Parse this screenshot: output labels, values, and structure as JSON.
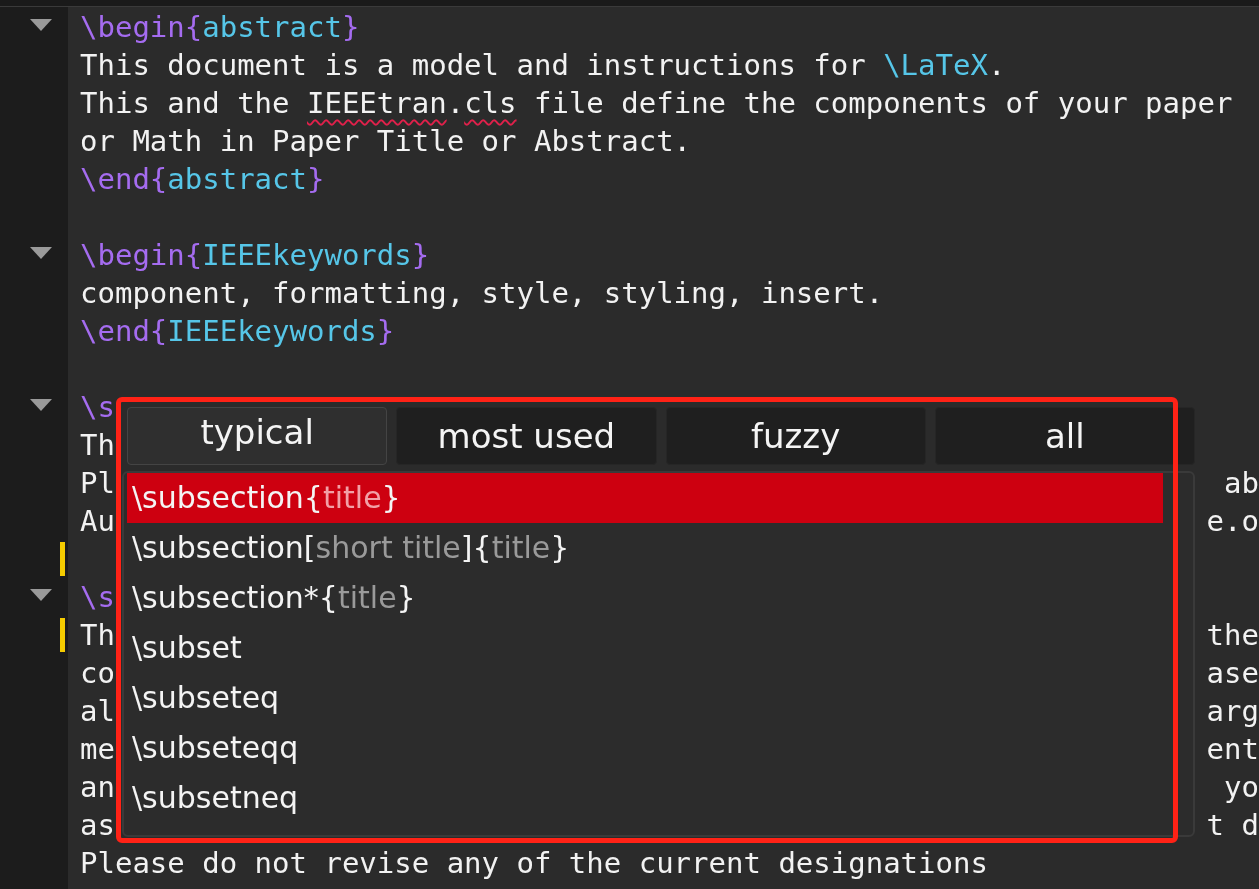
{
  "editor": {
    "lines": [
      {
        "fold": true,
        "marker": false,
        "left": [
          {
            "kind": "cmd",
            "text": "\\begin"
          },
          {
            "kind": "brace",
            "text": "{"
          },
          {
            "kind": "arg",
            "text": "abstract"
          },
          {
            "kind": "brace",
            "text": "}"
          }
        ]
      },
      {
        "fold": false,
        "marker": false,
        "left": [
          {
            "kind": "text",
            "text": "This document is a model and instructions for "
          },
          {
            "kind": "arg",
            "text": "\\LaTeX"
          },
          {
            "kind": "text",
            "text": "."
          }
        ]
      },
      {
        "fold": false,
        "marker": false,
        "left": [
          {
            "kind": "text",
            "text": "This and the "
          },
          {
            "kind": "misspelled",
            "text": "IEEEtran"
          },
          {
            "kind": "text",
            "text": "."
          },
          {
            "kind": "misspelled",
            "text": "cls"
          },
          {
            "kind": "text",
            "text": " file define the components of your paper"
          }
        ]
      },
      {
        "fold": false,
        "marker": false,
        "left": [
          {
            "kind": "text",
            "text": "or Math in Paper Title or Abstract."
          }
        ]
      },
      {
        "fold": false,
        "marker": false,
        "left": [
          {
            "kind": "cmd",
            "text": "\\end"
          },
          {
            "kind": "brace",
            "text": "{"
          },
          {
            "kind": "arg",
            "text": "abstract"
          },
          {
            "kind": "brace",
            "text": "}"
          }
        ]
      },
      {
        "fold": false,
        "marker": false
      },
      {
        "fold": true,
        "marker": false,
        "left": [
          {
            "kind": "cmd",
            "text": "\\begin"
          },
          {
            "kind": "brace",
            "text": "{"
          },
          {
            "kind": "arg",
            "text": "IEEEkeywords"
          },
          {
            "kind": "brace",
            "text": "}"
          }
        ]
      },
      {
        "fold": false,
        "marker": false,
        "left": [
          {
            "kind": "text",
            "text": "component, formatting, style, styling, insert."
          }
        ]
      },
      {
        "fold": false,
        "marker": false,
        "left": [
          {
            "kind": "cmd",
            "text": "\\end"
          },
          {
            "kind": "brace",
            "text": "{"
          },
          {
            "kind": "arg",
            "text": "IEEEkeywords"
          },
          {
            "kind": "brace",
            "text": "}"
          }
        ]
      },
      {
        "fold": false,
        "marker": false
      },
      {
        "fold": true,
        "marker": false,
        "left": [
          {
            "kind": "cmd",
            "text": "\\s"
          }
        ]
      },
      {
        "fold": false,
        "marker": false,
        "left": [
          {
            "kind": "text",
            "text": "Th"
          }
        ]
      },
      {
        "fold": false,
        "marker": false,
        "left": [
          {
            "kind": "text",
            "text": "Pl"
          }
        ],
        "right": "ab"
      },
      {
        "fold": false,
        "marker": false,
        "left": [
          {
            "kind": "text",
            "text": "Au"
          }
        ],
        "right": "e.o"
      },
      {
        "fold": false,
        "marker": true
      },
      {
        "fold": true,
        "marker": false,
        "left": [
          {
            "kind": "cmd",
            "text": "\\s"
          }
        ]
      },
      {
        "fold": false,
        "marker": true,
        "left": [
          {
            "kind": "text",
            "text": "Th"
          }
        ],
        "right": "the"
      },
      {
        "fold": false,
        "marker": false,
        "left": [
          {
            "kind": "text",
            "text": "co"
          }
        ],
        "right": "ase"
      },
      {
        "fold": false,
        "marker": false,
        "left": [
          {
            "kind": "text",
            "text": "al"
          }
        ],
        "right": "arg"
      },
      {
        "fold": false,
        "marker": false,
        "left": [
          {
            "kind": "text",
            "text": "me"
          }
        ],
        "right": "ent"
      },
      {
        "fold": false,
        "marker": false,
        "left": [
          {
            "kind": "text",
            "text": "an"
          }
        ],
        "right": "yo"
      },
      {
        "fold": false,
        "marker": false,
        "left": [
          {
            "kind": "text",
            "text": "as"
          }
        ],
        "right": "t d"
      },
      {
        "fold": false,
        "marker": false,
        "left": [
          {
            "kind": "text",
            "text": "Please do not revise any of the current designations"
          }
        ]
      }
    ]
  },
  "completion": {
    "tabs": [
      {
        "label": "typical",
        "selected": true
      },
      {
        "label": "most used",
        "selected": false
      },
      {
        "label": "fuzzy",
        "selected": false
      },
      {
        "label": "all",
        "selected": false
      }
    ],
    "items": [
      {
        "selected": true,
        "parts": [
          {
            "kind": "plain",
            "text": "\\subsection{"
          },
          {
            "kind": "placeholder",
            "text": "title"
          },
          {
            "kind": "plain",
            "text": "}"
          }
        ]
      },
      {
        "selected": false,
        "parts": [
          {
            "kind": "plain",
            "text": "\\subsection["
          },
          {
            "kind": "placeholder",
            "text": "short title"
          },
          {
            "kind": "plain",
            "text": "]{"
          },
          {
            "kind": "placeholder",
            "text": "title"
          },
          {
            "kind": "plain",
            "text": "}"
          }
        ]
      },
      {
        "selected": false,
        "parts": [
          {
            "kind": "plain",
            "text": "\\subsection*{"
          },
          {
            "kind": "placeholder",
            "text": "title"
          },
          {
            "kind": "plain",
            "text": "}"
          }
        ]
      },
      {
        "selected": false,
        "parts": [
          {
            "kind": "plain",
            "text": "\\subset"
          }
        ]
      },
      {
        "selected": false,
        "parts": [
          {
            "kind": "plain",
            "text": "\\subseteq"
          }
        ]
      },
      {
        "selected": false,
        "parts": [
          {
            "kind": "plain",
            "text": "\\subseteqq"
          }
        ]
      },
      {
        "selected": false,
        "parts": [
          {
            "kind": "plain",
            "text": "\\subsetneq"
          }
        ]
      }
    ]
  }
}
